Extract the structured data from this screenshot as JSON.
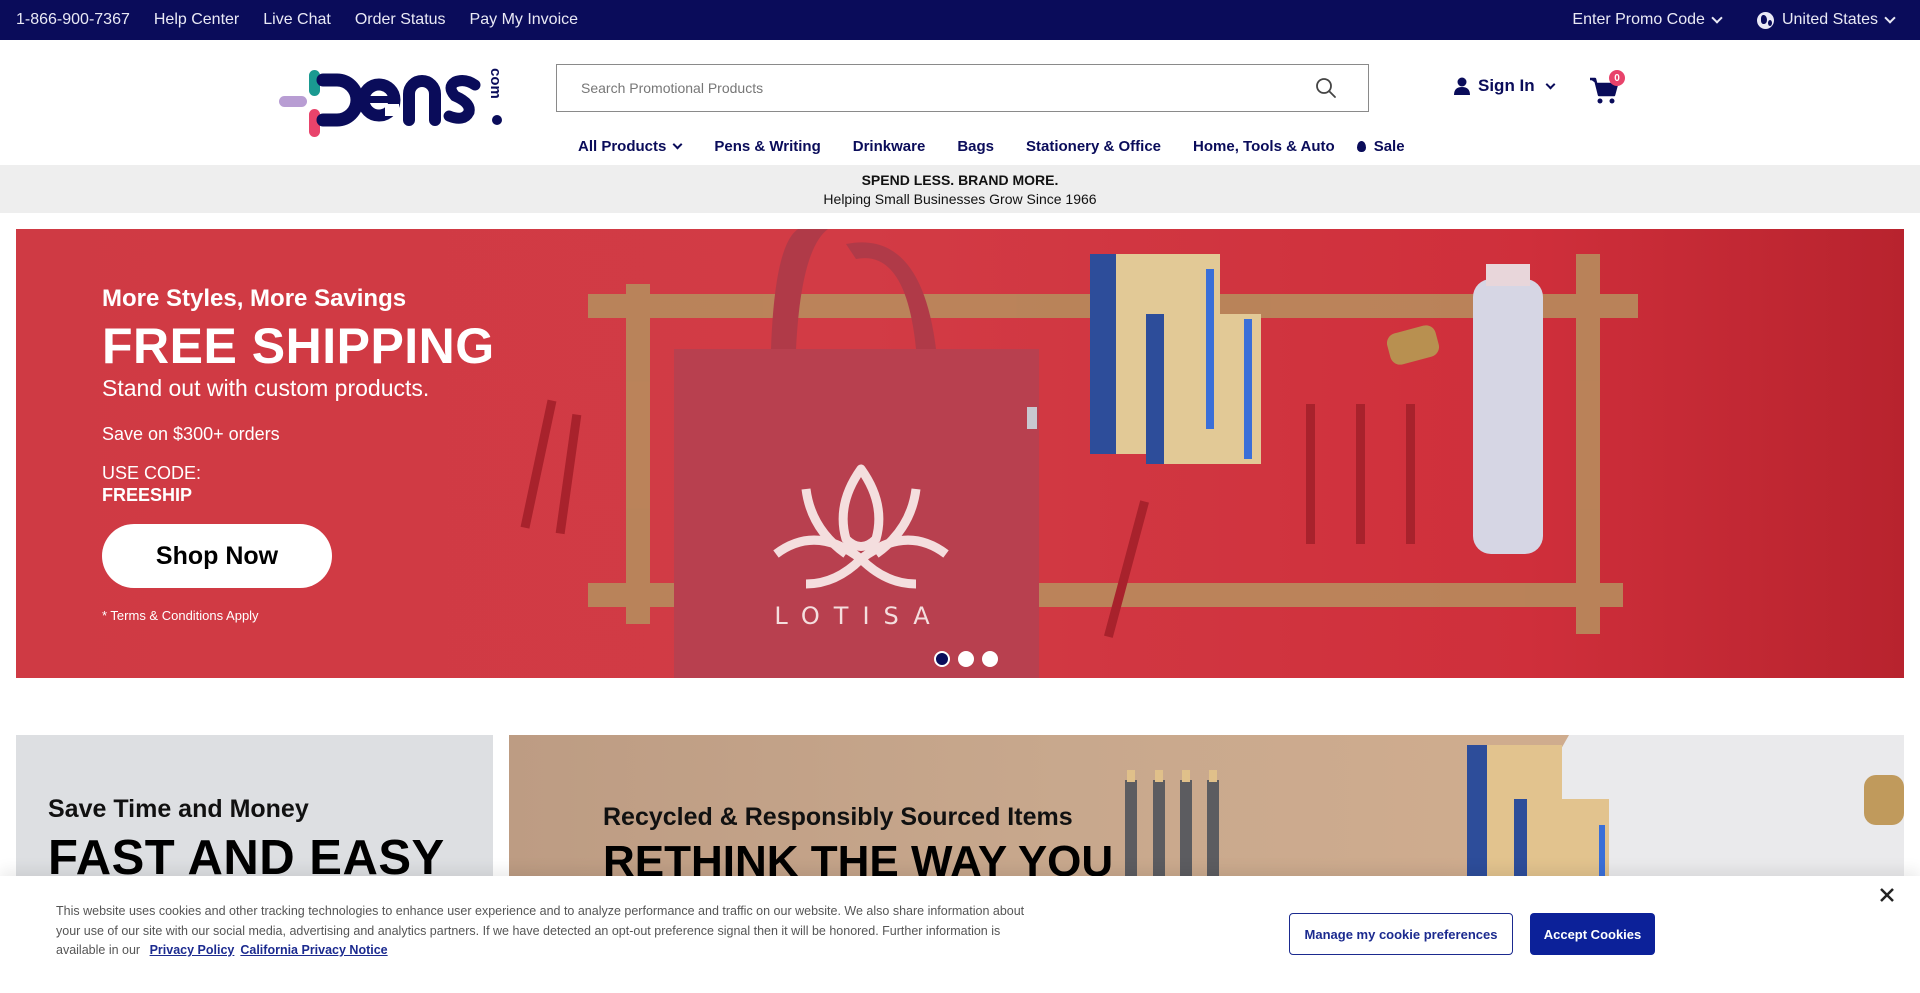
{
  "utility_bar": {
    "phone": "1-866-900-7367",
    "links": [
      "Help Center",
      "Live Chat",
      "Order Status",
      "Pay My Invoice"
    ],
    "promo_label": "Enter Promo Code",
    "country_label": "United States"
  },
  "header": {
    "logo_text": "pens",
    "logo_suffix": ".com",
    "search_placeholder": "Search Promotional Products",
    "search_value": "",
    "signin_label": "Sign In",
    "cart_count": "0"
  },
  "nav": {
    "items": [
      {
        "label": "All Products",
        "has_dropdown": true
      },
      {
        "label": "Pens & Writing"
      },
      {
        "label": "Drinkware"
      },
      {
        "label": "Bags"
      },
      {
        "label": "Stationery & Office"
      },
      {
        "label": "Home, Tools & Auto"
      },
      {
        "label": "Sale",
        "icon": "flame-icon"
      }
    ]
  },
  "tagline": {
    "headline": "SPEND LESS. BRAND MORE.",
    "subline": "Helping Small Businesses Grow Since 1966"
  },
  "hero": {
    "eyebrow": "More Styles, More Savings",
    "title": "FREE SHIPPING",
    "subtitle": "Stand out with custom products.",
    "save_text": "Save on $300+ orders",
    "code_label": "USE CODE:",
    "code": "FREESHIP",
    "cta_label": "Shop Now",
    "terms": "* Terms & Conditions Apply",
    "brand_mark": "LOTISA",
    "slides_total": 3,
    "active_slide": 1
  },
  "promo_cards": [
    {
      "eyebrow": "Save Time and Money",
      "title": "FAST AND EASY"
    },
    {
      "eyebrow": "Recycled & Responsibly Sourced Items",
      "title": "RETHINK THE WAY YOU"
    }
  ],
  "cookie_banner": {
    "text": "This website uses cookies and other tracking technologies to enhance user experience and to analyze performance and traffic on our website. We also share information about your use of our site with our social media, advertising and analytics partners. If we have detected an opt-out preference signal then it will be honored. Further information is available in our",
    "privacy_link": "Privacy Policy",
    "california_link": "California Privacy Notice",
    "manage_label": "Manage my cookie preferences",
    "accept_label": "Accept Cookies"
  },
  "colors": {
    "navy": "#0a0c5a",
    "hero_red": "#d23b45",
    "badge_pink": "#e8436b",
    "accept_blue": "#0c2199",
    "logo_teal": "#1a9a91",
    "logo_lavender": "#b89dd3"
  }
}
